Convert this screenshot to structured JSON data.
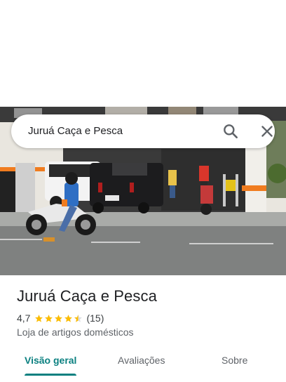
{
  "search": {
    "query": "Juruá Caça e Pesca"
  },
  "place": {
    "name": "Juruá Caça e Pesca",
    "rating": "4,7",
    "stars": 4.7,
    "review_count": "(15)",
    "category": "Loja de artigos domésticos"
  },
  "tabs": [
    {
      "label": "Visão geral",
      "selected": true
    },
    {
      "label": "Avaliações",
      "selected": false
    },
    {
      "label": "Sobre",
      "selected": false
    }
  ],
  "colors": {
    "accent": "#0b8080",
    "star": "#fbbc04",
    "text_primary": "#202124",
    "text_secondary": "#5f6368"
  },
  "icons": {
    "search": "search-icon",
    "close": "close-icon",
    "star": "star-icon"
  }
}
